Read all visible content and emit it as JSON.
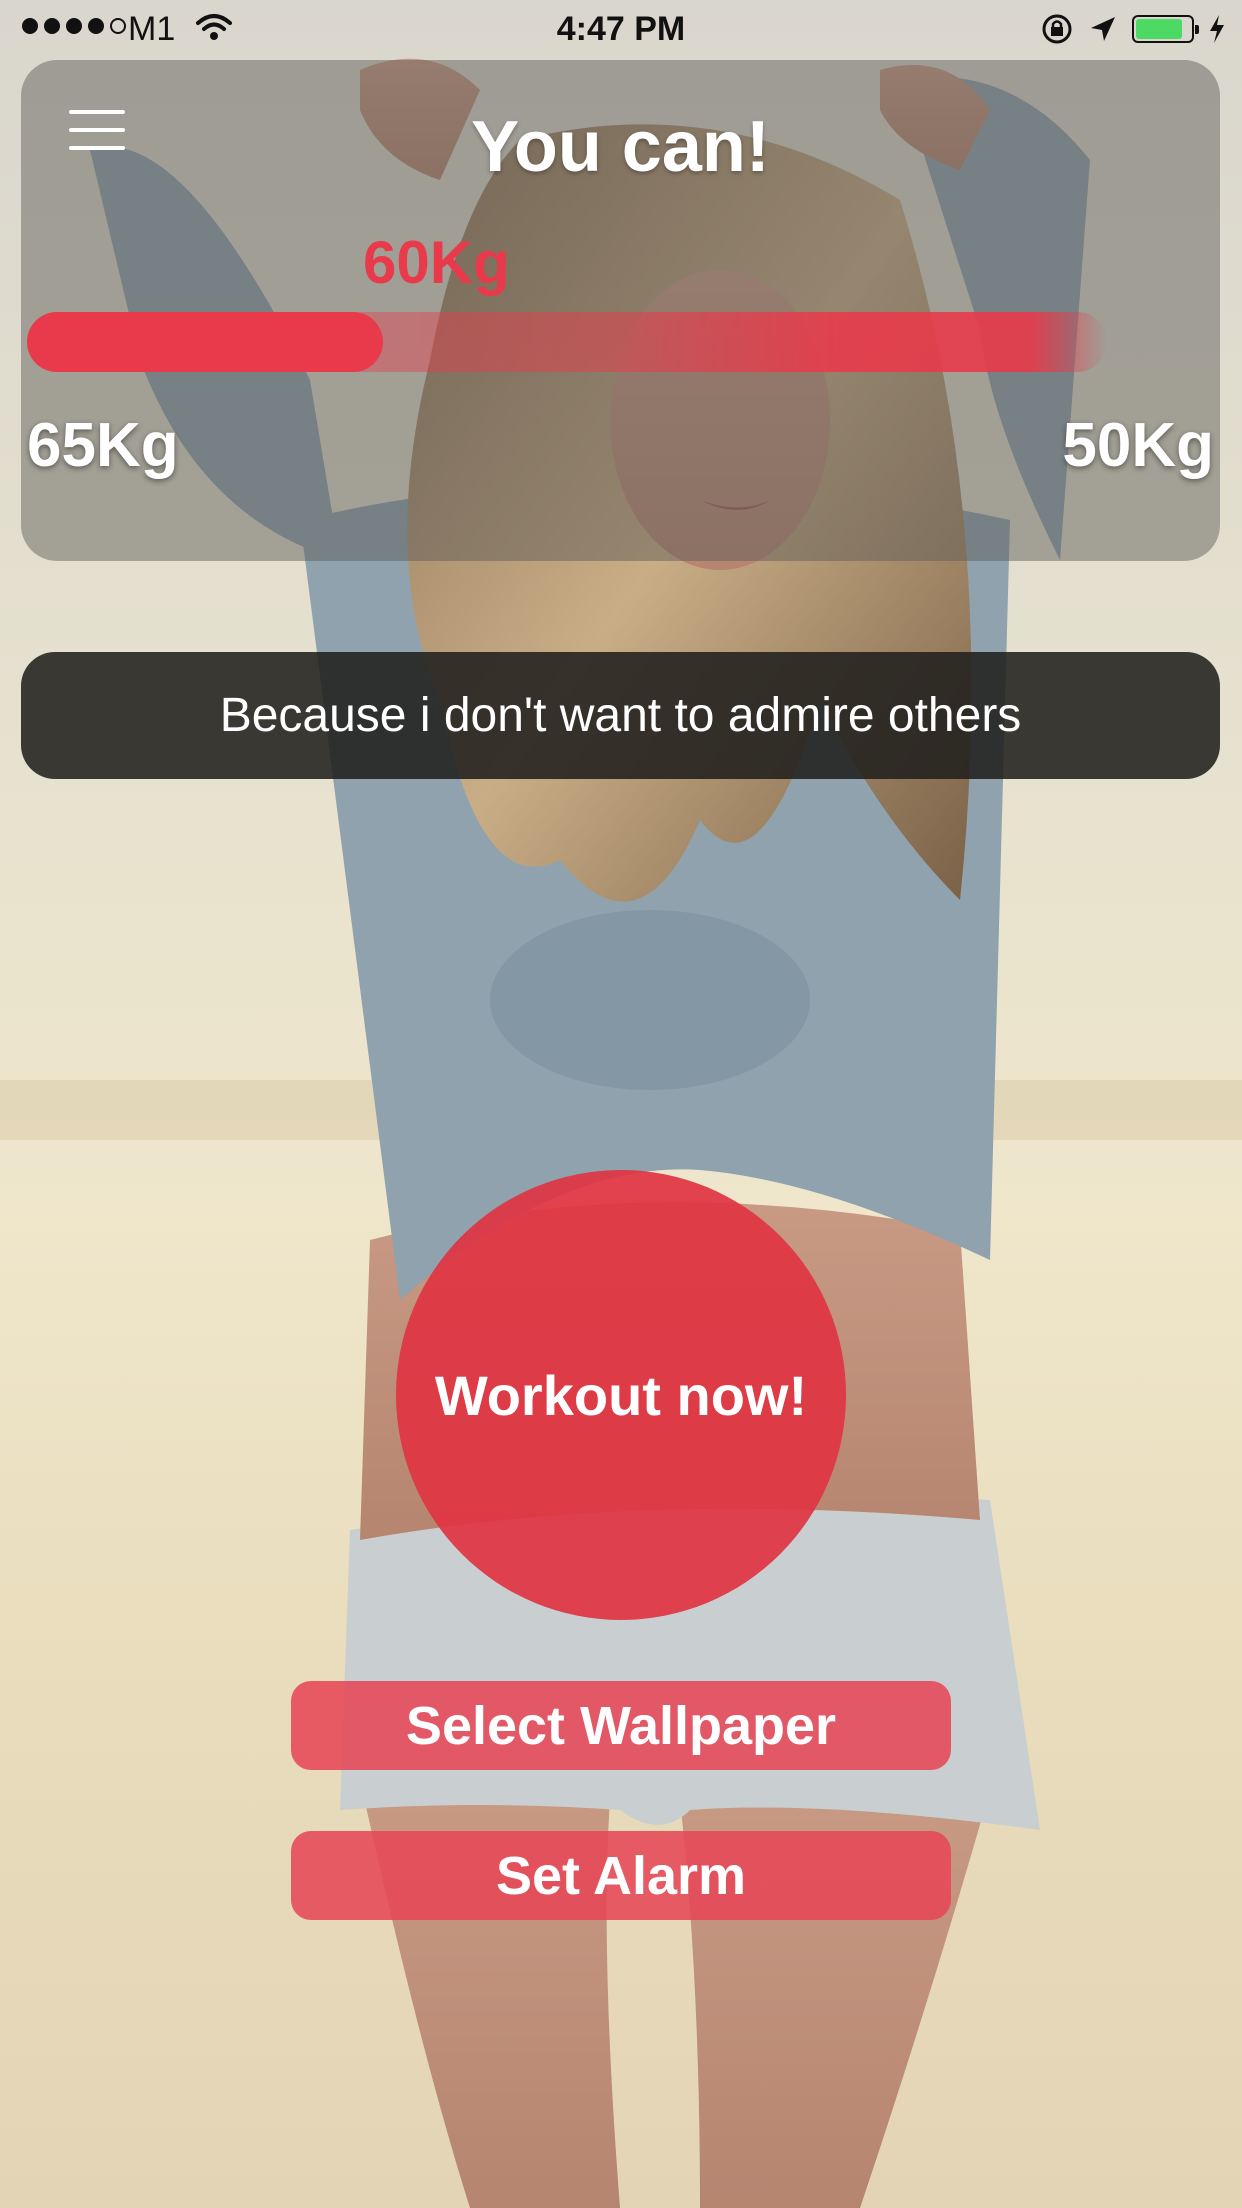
{
  "status_bar": {
    "carrier": "M1",
    "time": "4:47 PM",
    "battery_level": 0.85,
    "icons": [
      "signal-dots-icon",
      "wifi-icon",
      "rotation-lock-icon",
      "location-arrow-icon",
      "battery-icon",
      "charging-bolt-icon"
    ]
  },
  "header": {
    "title": "You can!",
    "menu_icon": "hamburger-menu-icon",
    "current_weight": "60Kg",
    "start_weight": "65Kg",
    "goal_weight": "50Kg",
    "progress_fraction": 0.33
  },
  "motivation": {
    "text": "Because i don't want to admire others"
  },
  "actions": {
    "workout_label": "Workout now!",
    "select_wallpaper_label": "Select Wallpaper",
    "set_alarm_label": "Set Alarm"
  },
  "colors": {
    "accent": "#e83a4a",
    "battery_fill": "#4cd964",
    "banner_background": "#21201e"
  }
}
